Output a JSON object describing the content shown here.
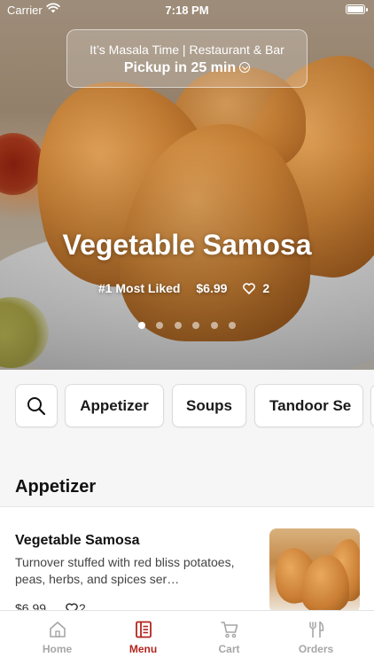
{
  "status_bar": {
    "carrier": "Carrier",
    "time": "7:18 PM"
  },
  "restaurant": {
    "name": "It’s Masala Time | Restaurant & Bar",
    "pickup": "Pickup in 25 min"
  },
  "featured": {
    "title": "Vegetable Samosa",
    "badge": "#1 Most Liked",
    "price": "$6.99",
    "likes": "2",
    "slides_total": 6,
    "active_slide": 1
  },
  "categories": {
    "search_icon": "search-icon",
    "items": [
      "Appetizer",
      "Soups",
      "Tandoor Se"
    ]
  },
  "menu": {
    "section_title": "Appetizer",
    "items": [
      {
        "name": "Vegetable Samosa",
        "description": "Turnover stuffed with red bliss potatoes, peas, herbs, and spices ser…",
        "price": "$6.99",
        "likes": "2"
      }
    ]
  },
  "tabs": [
    {
      "label": "Home",
      "icon": "home-icon",
      "active": false
    },
    {
      "label": "Menu",
      "icon": "menu-icon",
      "active": true
    },
    {
      "label": "Cart",
      "icon": "cart-icon",
      "active": false
    },
    {
      "label": "Orders",
      "icon": "fork-knife-icon",
      "active": false
    }
  ],
  "colors": {
    "accent": "#b3261e",
    "inactive_tab": "#a6a6a6"
  }
}
